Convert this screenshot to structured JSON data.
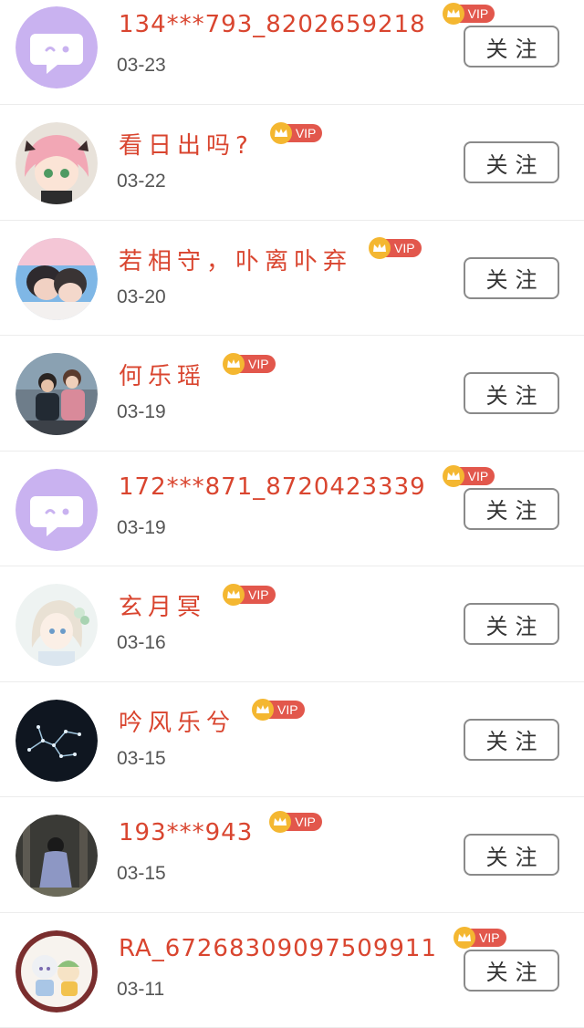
{
  "vip_label": "VIP",
  "follow_label": "关注",
  "colors": {
    "name": "#d9452f",
    "vip_tag": "#e2574c",
    "crown": "#f4b731",
    "default_avatar": "#c9b2f0"
  },
  "users": [
    {
      "name": "134***793_8202659218",
      "date": "03-23",
      "avatar": "default-chat-avatar"
    },
    {
      "name": "看日出吗?",
      "date": "03-22",
      "avatar": "anime-girl-pink-hair"
    },
    {
      "name": "若相守，卟离卟弃",
      "date": "03-20",
      "avatar": "couple-photo"
    },
    {
      "name": "何乐瑶",
      "date": "03-19",
      "avatar": "friends-photo"
    },
    {
      "name": "172***871_8720423339",
      "date": "03-19",
      "avatar": "default-chat-avatar"
    },
    {
      "name": "玄月冥",
      "date": "03-16",
      "avatar": "anime-girl-flowers"
    },
    {
      "name": "吟风乐兮",
      "date": "03-15",
      "avatar": "constellation-dark"
    },
    {
      "name": "193***943",
      "date": "03-15",
      "avatar": "girl-in-forest"
    },
    {
      "name": "RA_67268309097509911",
      "date": "03-11",
      "avatar": "anime-chibi-pair"
    }
  ]
}
